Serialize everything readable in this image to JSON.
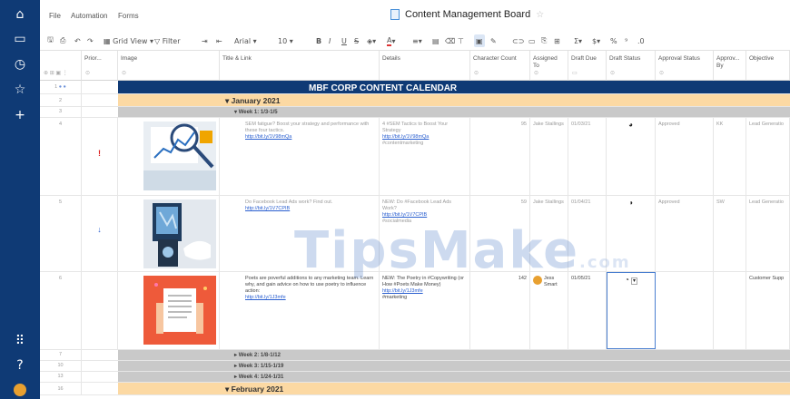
{
  "menu": {
    "file": "File",
    "automation": "Automation",
    "forms": "Forms"
  },
  "sheet_title": "Content Management Board",
  "toolbar": {
    "grid_view": "Grid View",
    "filter": "Filter",
    "font": "Arial",
    "size": "10"
  },
  "columns": {
    "priority": "Prior...",
    "image": "Image",
    "title_link": "Title & Link",
    "details": "Details",
    "char_count": "Character Count",
    "assigned_to": "Assigned To",
    "draft_due": "Draft Due",
    "draft_status": "Draft Status",
    "approval_status": "Approval Status",
    "approved_by": "Approv... By",
    "objective": "Objective"
  },
  "banner": "MBF CORP CONTENT CALENDAR",
  "months": {
    "jan": "January 2021",
    "feb": "February 2021"
  },
  "weeks": {
    "w1": "Week 1: 1/3-1/5",
    "w2": "Week 2: 1/8-1/12",
    "w3": "Week 3: 1/15-1/19",
    "w4": "Week 4: 1/24-1/31"
  },
  "rownums": [
    "1",
    "2",
    "3",
    "4",
    "5",
    "6",
    "7",
    "10",
    "13",
    "16"
  ],
  "rows": [
    {
      "title": "SEM fatigue? Boost your strategy and performance with these four tactics.",
      "link": "http://bit.ly/1V98mQa",
      "details": "4 #SEM Tactics to Boost Your Strategy",
      "details_link": "http://bit.ly/1V98mQa",
      "hashtag": "#contentmarketing",
      "count": "95",
      "assigned": "Jake Stallings",
      "due": "01/03/21",
      "approval": "Approved",
      "approver": "KK",
      "objective": "Lead Generatio"
    },
    {
      "title": "Do Facebook Lead Ads work? Find out.",
      "link": "http://bit.ly/1V7CPIB",
      "details": "NEW: Do #Facebook Lead Ads Work?",
      "details_link": "http://bit.ly/1V7CPIB",
      "hashtag": "#socialmedia",
      "count": "59",
      "assigned": "Jake Stallings",
      "due": "01/04/21",
      "approval": "Approved",
      "approver": "SW",
      "objective": "Lead Generatio"
    },
    {
      "title": "Poets are poverful additions to any marketing team. Learn why, and gain advice on how to use poetry to influence action:",
      "link": "http://bit.ly/1J3mfe",
      "details": "NEW: The Poetry in #Copywriting (or How #Poets Make Money)",
      "details_link": "http://bit.ly/1J3mfe",
      "hashtag": "#marketing",
      "count": "142",
      "assigned": "Jess Smart",
      "due": "01/05/21",
      "approval": "",
      "approver": "",
      "objective": "Customer Supp"
    }
  ],
  "priority_marks": [
    "!",
    "↓"
  ],
  "watermark": {
    "main": "TipsMake",
    "suffix": ".com"
  },
  "colors": {
    "nav": "#0f3a75",
    "month_band": "#fcd9a3",
    "week_band": "#c9c9c9",
    "link": "#2a5fd0"
  }
}
